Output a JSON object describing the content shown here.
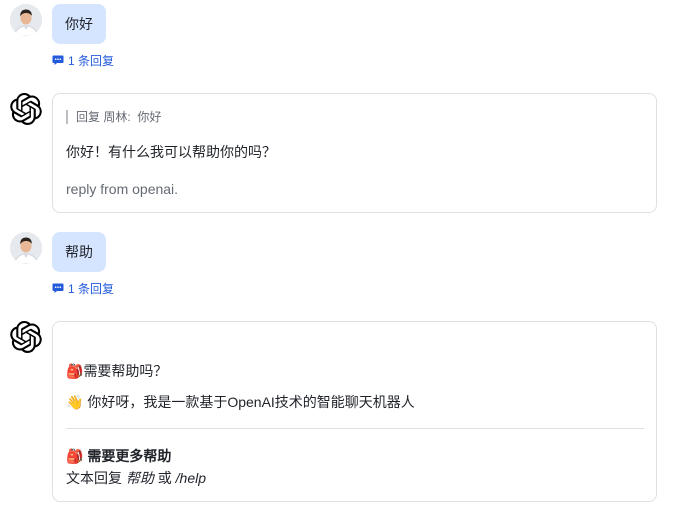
{
  "messages": [
    {
      "role": "user",
      "text": "你好",
      "reply_count": "1 条回复"
    },
    {
      "role": "assistant",
      "quote_prefix": "回复",
      "quote_user": "周林:",
      "quote_text": "你好",
      "text": "你好！有什么我可以帮助你的吗？",
      "footer": "reply from openai."
    },
    {
      "role": "user",
      "text": "帮助",
      "reply_count": "1 条回复"
    },
    {
      "role": "assistant",
      "line1_emoji": "🎒",
      "line1": "需要帮助吗？",
      "line2_emoji": "👋",
      "line2": "你好呀，我是一款基于OpenAI技术的智能聊天机器人",
      "help_emoji": "🎒",
      "help_title": "需要更多帮助",
      "help_text_prefix": "文本回复",
      "help_kw1": "帮助",
      "help_or": "或",
      "help_kw2": "/help"
    }
  ],
  "icons": {
    "avatar": "user-avatar",
    "assistant": "openai-logo-icon",
    "reply": "comment-icon"
  },
  "colors": {
    "bubble": "#d6e5ff",
    "link": "#245bdb",
    "border": "#dee0e3"
  }
}
